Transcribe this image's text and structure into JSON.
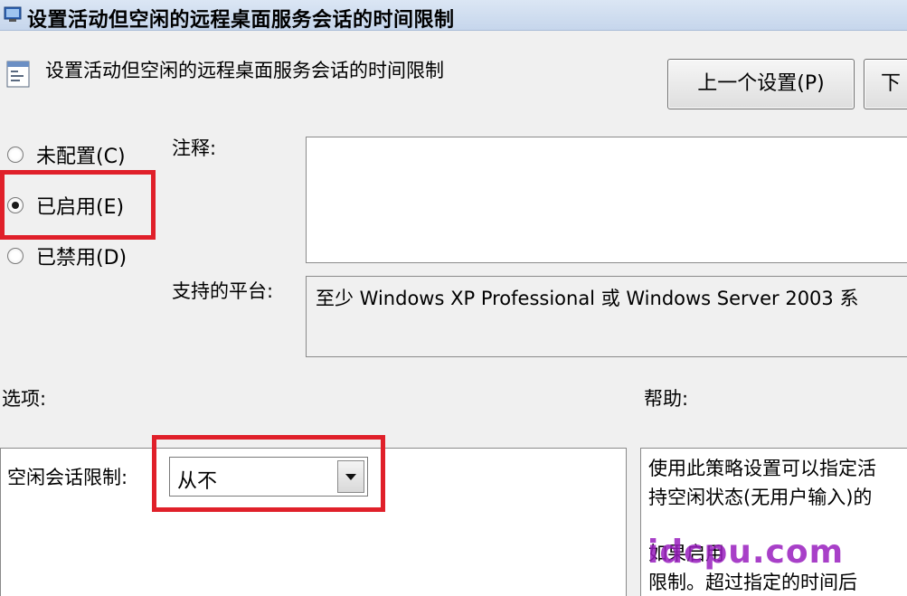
{
  "window": {
    "title": "设置活动但空闲的远程桌面服务会话的时间限制"
  },
  "header": {
    "policy_name": "设置活动但空闲的远程桌面服务会话的时间限制",
    "prev_button": "上一个设置(P)",
    "next_button": "下"
  },
  "state": {
    "options": [
      {
        "label": "未配置(C)",
        "checked": false
      },
      {
        "label": "已启用(E)",
        "checked": true
      },
      {
        "label": "已禁用(D)",
        "checked": false
      }
    ]
  },
  "comment": {
    "label": "注释:",
    "value": ""
  },
  "platform": {
    "label": "支持的平台:",
    "value": "至少 Windows XP Professional 或 Windows Server 2003 系"
  },
  "options_section": {
    "label": "选项:",
    "idle_limit_label": "空闲会话限制:",
    "idle_limit_value": "从不"
  },
  "help_section": {
    "label": "帮助:",
    "lines": [
      "使用此策略设置可以指定活",
      "持空闲状态(无用户输入)的",
      "如果启用",
      "限制。超过指定的时间后"
    ]
  },
  "watermark": "idcpu.com",
  "colors": {
    "highlight": "#e0202a",
    "titlebar": "#c6d6ec"
  }
}
